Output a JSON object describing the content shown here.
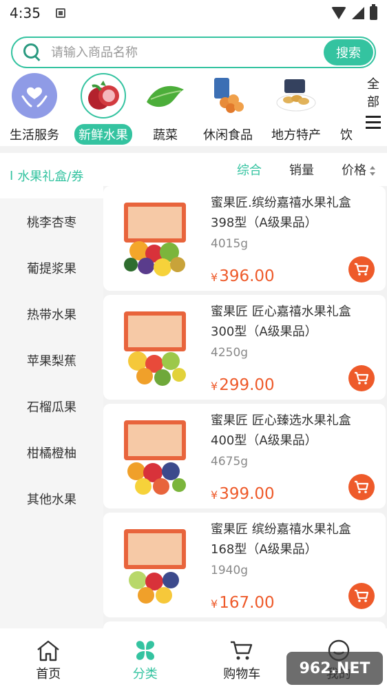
{
  "status_bar": {
    "time": "4:35"
  },
  "search": {
    "placeholder": "请输入商品名称",
    "button_label": "搜索"
  },
  "categories": [
    {
      "label": "生活服务",
      "icon": "heart-hands-icon",
      "active": false
    },
    {
      "label": "新鲜水果",
      "icon": "pomegranate-icon",
      "active": true
    },
    {
      "label": "蔬菜",
      "icon": "lettuce-icon",
      "active": false
    },
    {
      "label": "休闲食品",
      "icon": "snack-icon",
      "active": false
    },
    {
      "label": "地方特产",
      "icon": "specialty-icon",
      "active": false
    },
    {
      "label": "饮",
      "icon": "drink-icon",
      "active": false
    }
  ],
  "all_categories_label": {
    "line1": "全",
    "line2": "部"
  },
  "sidebar": {
    "items": [
      "水果礼盒/券",
      "桃李杏枣",
      "葡提浆果",
      "热带水果",
      "苹果梨蕉",
      "石榴瓜果",
      "柑橘橙柚",
      "其他水果"
    ]
  },
  "sort": {
    "comprehensive": "综合",
    "sales": "销量",
    "price": "价格"
  },
  "products": [
    {
      "name": "蜜果匠.缤纷嘉禧水果礼盒398型（A级果品）",
      "weight": "4015g",
      "currency": "¥",
      "price": "396.00"
    },
    {
      "name": "蜜果匠 匠心嘉禧水果礼盒300型（A级果品）",
      "weight": "4250g",
      "currency": "¥",
      "price": "299.00"
    },
    {
      "name": "蜜果匠 匠心臻选水果礼盒400型（A级果品）",
      "weight": "4675g",
      "currency": "¥",
      "price": "399.00"
    },
    {
      "name": "蜜果匠 缤纷嘉禧水果礼盒168型（A级果品）",
      "weight": "1940g",
      "currency": "¥",
      "price": "167.00"
    }
  ],
  "bottom_nav": [
    {
      "label": "首页",
      "icon": "home-icon"
    },
    {
      "label": "分类",
      "icon": "category-icon"
    },
    {
      "label": "购物车",
      "icon": "cart-icon"
    },
    {
      "label": "我的",
      "icon": "user-icon"
    }
  ],
  "watermark": "962.NET",
  "colors": {
    "accent": "#34c3a0",
    "price": "#ee5a2a"
  }
}
